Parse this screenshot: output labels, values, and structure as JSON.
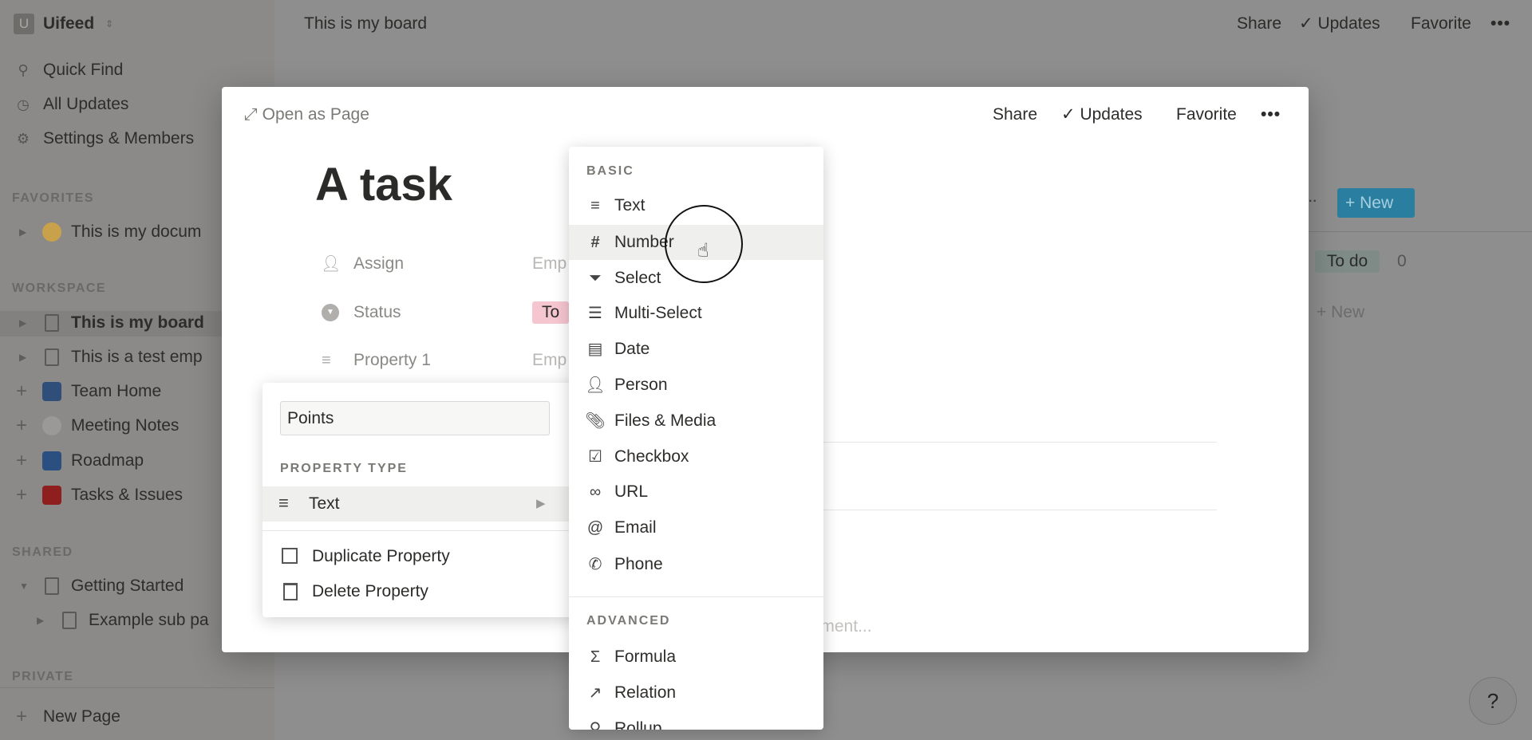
{
  "sidebar": {
    "workspace_initial": "U",
    "workspace_name": "Uifeed",
    "top_items": [
      "Quick Find",
      "All Updates",
      "Settings & Members"
    ],
    "favorites_label": "FAVORITES",
    "favorites": [
      "This is my docum"
    ],
    "workspace_label": "WORKSPACE",
    "workspace_items": [
      "This is my board",
      "This is a test emp",
      "Team Home",
      "Meeting Notes",
      "Roadmap",
      "Tasks & Issues"
    ],
    "shared_label": "SHARED",
    "shared_items": [
      "Getting Started",
      "Example sub pa"
    ],
    "private_label": "PRIVATE",
    "new_page": "New Page"
  },
  "topbar": {
    "title": "This is my board",
    "share": "Share",
    "updates": "Updates",
    "favorite": "Favorite"
  },
  "board": {
    "new_button": "New",
    "group_tag": "To do",
    "group_count": "0",
    "add_new": "New",
    "accent": "#2a7fa0"
  },
  "modal": {
    "open_as_page": "Open as Page",
    "share": "Share",
    "updates": "Updates",
    "favorite": "Favorite",
    "title": "A task",
    "properties": [
      {
        "label": "Assign",
        "value": "Emp",
        "icon": "person-icon"
      },
      {
        "label": "Status",
        "value": "To",
        "icon": "select-icon"
      },
      {
        "label": "Property 1",
        "value": "Emp",
        "icon": "text-icon"
      }
    ],
    "comment_placeholder": "Add a comment..."
  },
  "property_popup": {
    "name_value": "Points",
    "type_label": "PROPERTY TYPE",
    "type_value": "Text",
    "duplicate": "Duplicate Property",
    "delete": "Delete Property"
  },
  "type_menu": {
    "basic_label": "BASIC",
    "basic": [
      {
        "label": "Text",
        "icon": "text-icon"
      },
      {
        "label": "Number",
        "icon": "hash-icon"
      },
      {
        "label": "Select",
        "icon": "select-icon"
      },
      {
        "label": "Multi-Select",
        "icon": "list-icon"
      },
      {
        "label": "Date",
        "icon": "calendar-icon"
      },
      {
        "label": "Person",
        "icon": "person-icon"
      },
      {
        "label": "Files & Media",
        "icon": "paperclip-icon"
      },
      {
        "label": "Checkbox",
        "icon": "checkbox-icon"
      },
      {
        "label": "URL",
        "icon": "link-icon"
      },
      {
        "label": "Email",
        "icon": "at-icon"
      },
      {
        "label": "Phone",
        "icon": "phone-icon"
      }
    ],
    "advanced_label": "ADVANCED",
    "advanced": [
      {
        "label": "Formula",
        "icon": "sigma-icon"
      },
      {
        "label": "Relation",
        "icon": "arrow-icon"
      },
      {
        "label": "Rollup",
        "icon": "search-icon"
      }
    ],
    "highlighted": "Number"
  },
  "help": "?"
}
